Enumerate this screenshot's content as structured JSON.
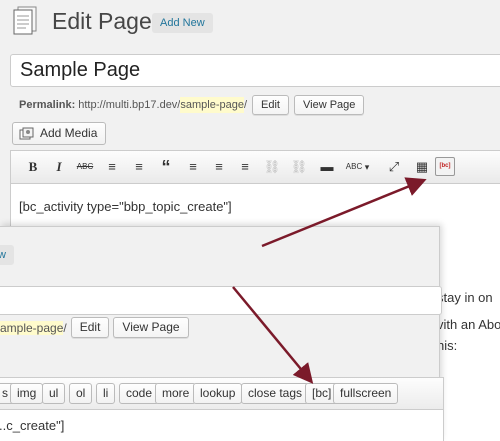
{
  "header": {
    "title": "Edit Page",
    "add_new_label": "Add New",
    "post_title": "Sample Page"
  },
  "permalink": {
    "label": "Permalink:",
    "base": "http://multi.bp17.dev/",
    "slug": "sample-page",
    "slash": "/",
    "edit_label": "Edit",
    "view_label": "View Page"
  },
  "add_media_label": "Add Media",
  "visual_toolbar": {
    "buttons": [
      "B",
      "I",
      "ABC",
      "≡",
      "≡",
      "“",
      "≡",
      "≡",
      "≡",
      "⛓",
      "⛓",
      "▬",
      "ABC",
      "▾",
      "⤢",
      "▦",
      "[bc]"
    ]
  },
  "editor_content": "[bc_activity type=\"bbp_topic_create\"]",
  "background_text": {
    "line1": "stay in on",
    "line2": "vith an Abo",
    "line3": "his:"
  },
  "inset": {
    "partial_add_new": "w",
    "permalink_partial_slug": "ample-page",
    "permalink_slash": "/",
    "edit_label": "Edit",
    "view_label": "View Page",
    "quicktags": [
      "s",
      "img",
      "ul",
      "ol",
      "li",
      "code",
      "more",
      "lookup",
      "close tags",
      "[bc]",
      "fullscreen"
    ],
    "content_partial": "..c_create\"]"
  },
  "colors": {
    "arrow": "#7b1a2a",
    "link": "#21759b",
    "slug_highlight": "#fffbcc"
  }
}
